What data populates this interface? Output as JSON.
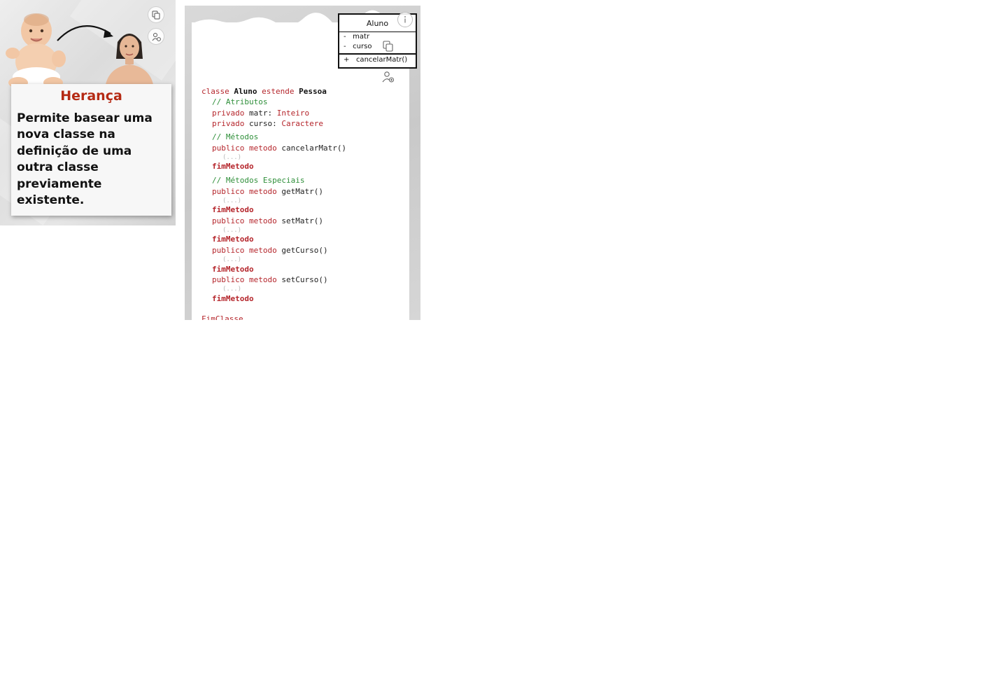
{
  "left_slide": {
    "title": "Herança",
    "body_lines": [
      "Permite basear uma",
      "nova classe na",
      "definição de uma",
      "outra classe",
      "previamente",
      "existente."
    ],
    "title_color": "#b52a14",
    "icons": [
      "copy-to-clipboard-icon",
      "user-add-icon"
    ]
  },
  "right_slide": {
    "uml": {
      "class_name": "Aluno",
      "attributes": [
        {
          "visibility": "-",
          "name": "matr"
        },
        {
          "visibility": "-",
          "name": "curso"
        }
      ],
      "operations": [
        {
          "visibility": "+",
          "name": "cancelarMatr()"
        }
      ]
    },
    "code": {
      "line1": {
        "kw": "classe",
        "name": "Aluno",
        "kw2": "estende",
        "parent": "Pessoa"
      },
      "comment_atributos": "// Atributos",
      "attr1": {
        "kw": "privado",
        "name": "matr:",
        "type": "Inteiro"
      },
      "attr2": {
        "kw": "privado",
        "name": "curso:",
        "type": "Caractere"
      },
      "comment_metodos": "// Métodos",
      "method1": {
        "kw": "publico metodo",
        "name": "cancelarMatr()"
      },
      "ellipsis": "(...)",
      "end_method": "fimMetodo",
      "comment_especiais": "// Métodos Especiais",
      "method2": {
        "kw": "publico metodo",
        "name": "getMatr()"
      },
      "method3": {
        "kw": "publico metodo",
        "name": "setMatr()"
      },
      "method4": {
        "kw": "publico metodo",
        "name": "getCurso()"
      },
      "method5": {
        "kw": "publico metodo",
        "name": "setCurso()"
      },
      "end_class": "FimClasse"
    },
    "colors": {
      "keyword": "#b5262c",
      "comment": "#2f8f3a"
    },
    "icons": [
      "info-icon",
      "copy-to-clipboard-icon",
      "user-add-icon"
    ]
  }
}
